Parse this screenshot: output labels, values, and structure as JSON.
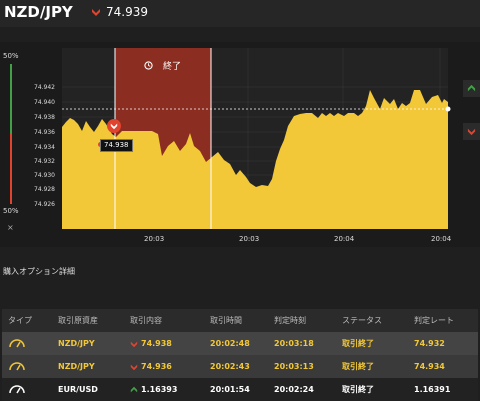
{
  "header": {
    "pair": "NZD/JPY",
    "price": "74.939",
    "direction": "down"
  },
  "side_gauge": {
    "top_percent": "50%",
    "bottom_percent": "50%",
    "close_symbol": "×"
  },
  "chart": {
    "y_ticks": [
      "74.942",
      "74.940",
      "74.938",
      "74.936",
      "74.934",
      "74.932",
      "74.930",
      "74.928",
      "74.926"
    ],
    "x_ticks": [
      "20:03",
      "20:03",
      "20:04",
      "20:04"
    ],
    "end_label": "終了",
    "entry_price": "74.938",
    "colors": {
      "area": "#f2c838",
      "closed_zone": "#8b2d20",
      "up": "#43a047",
      "down": "#e0442e"
    }
  },
  "details": {
    "title": "購入オプション詳細",
    "columns": [
      "タイプ",
      "取引原資産",
      "取引内容",
      "取引時間",
      "判定時刻",
      "ステータス",
      "判定レート"
    ],
    "rows": [
      {
        "asset": "NZD/JPY",
        "direction": "down",
        "rate": "74.938",
        "trade_time": "20:02:48",
        "judge_time": "20:03:18",
        "status": "取引終了",
        "judge_rate": "74.932"
      },
      {
        "asset": "NZD/JPY",
        "direction": "down",
        "rate": "74.936",
        "trade_time": "20:02:43",
        "judge_time": "20:03:13",
        "status": "取引終了",
        "judge_rate": "74.934"
      },
      {
        "asset": "EUR/USD",
        "direction": "up",
        "rate": "1.16393",
        "trade_time": "20:01:54",
        "judge_time": "20:02:24",
        "status": "取引終了",
        "judge_rate": "1.16391"
      }
    ]
  }
}
